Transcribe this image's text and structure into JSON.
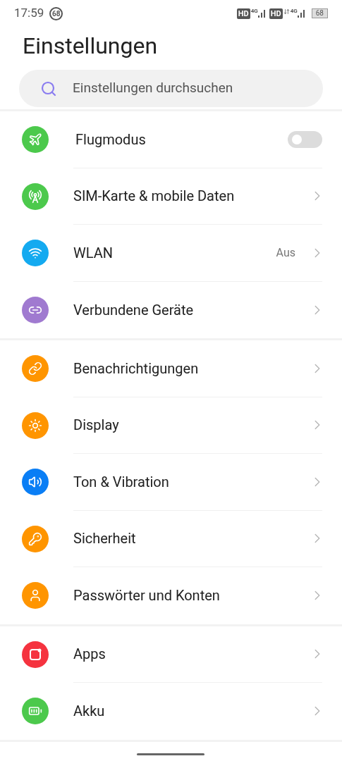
{
  "status_bar": {
    "time": "17:59",
    "notification_badge": "68",
    "sims": [
      {
        "hd": "HD",
        "network": "4G",
        "data_activity": false
      },
      {
        "hd": "HD",
        "network": "4G",
        "data_activity": true
      }
    ],
    "battery": "68"
  },
  "title": "Einstellungen",
  "search": {
    "placeholder": "Einstellungen durchsuchen"
  },
  "groups": [
    {
      "items": [
        {
          "label": "Flugmodus",
          "color": "#4cc94c",
          "kind": "toggle",
          "on": false
        },
        {
          "label": "SIM-Karte & mobile Daten",
          "color": "#4cc94c",
          "kind": "link"
        },
        {
          "label": "WLAN",
          "color": "#14aaf0",
          "kind": "link",
          "value": "Aus"
        },
        {
          "label": "Verbundene Geräte",
          "color": "#a07ad0",
          "kind": "link"
        }
      ]
    },
    {
      "items": [
        {
          "label": "Benachrichtigungen",
          "color": "#ff9500",
          "kind": "link"
        },
        {
          "label": "Display",
          "color": "#ff9500",
          "kind": "link"
        },
        {
          "label": "Ton & Vibration",
          "color": "#0a7ef5",
          "kind": "link"
        },
        {
          "label": "Sicherheit",
          "color": "#ff9500",
          "kind": "link"
        },
        {
          "label": "Passwörter und Konten",
          "color": "#ff9500",
          "kind": "link"
        }
      ]
    },
    {
      "items": [
        {
          "label": "Apps",
          "color": "#f5333f",
          "kind": "link"
        },
        {
          "label": "Akku",
          "color": "#4cc94c",
          "kind": "link"
        }
      ]
    }
  ]
}
